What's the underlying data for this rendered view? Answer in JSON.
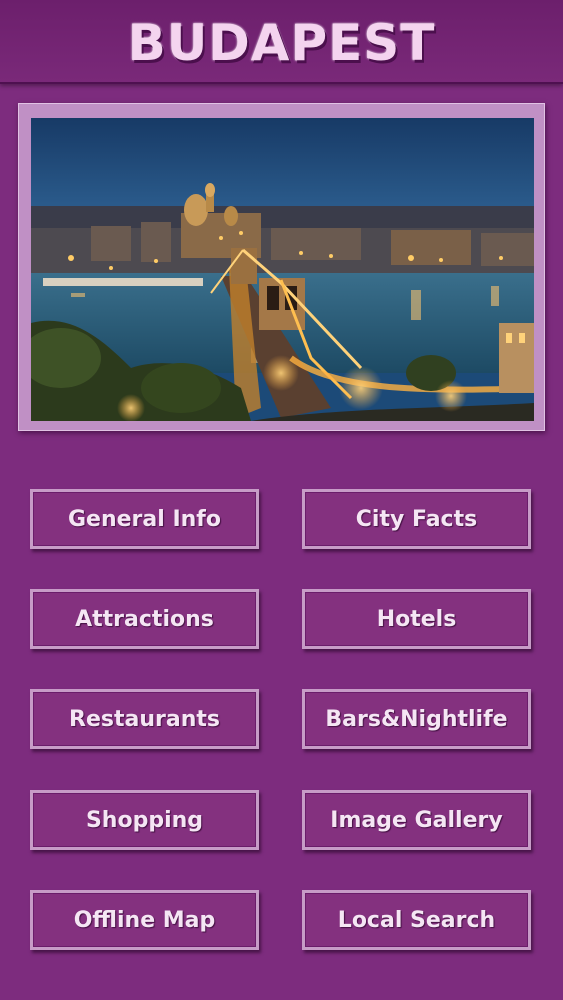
{
  "header": {
    "title": "BUDAPEST"
  },
  "hero": {
    "image_subject": "Budapest Chain Bridge at night"
  },
  "menu": {
    "general_info": "General Info",
    "city_facts": "City Facts",
    "attractions": "Attractions",
    "hotels": "Hotels",
    "restaurants": "Restaurants",
    "bars_nightlife": "Bars&Nightlife",
    "shopping": "Shopping",
    "image_gallery": "Image Gallery",
    "offline_map": "Offline Map",
    "local_search": "Local Search"
  },
  "colors": {
    "background": "#7d2c7e",
    "button_border": "#c79cc7",
    "title_text": "#f4d4ef"
  }
}
